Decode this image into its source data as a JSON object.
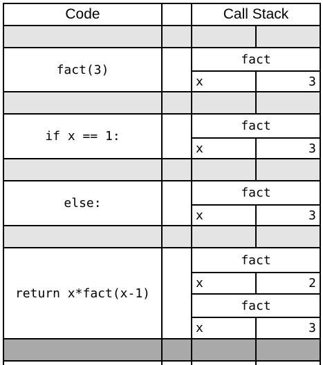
{
  "headers": {
    "code": "Code",
    "call_stack": "Call Stack"
  },
  "rows": [
    {
      "code": "fact(3)",
      "frames": [
        {
          "name": "fact",
          "var": "x",
          "value": "3"
        }
      ]
    },
    {
      "code": "if x == 1:",
      "frames": [
        {
          "name": "fact",
          "var": "x",
          "value": "3"
        }
      ]
    },
    {
      "code": "else:",
      "frames": [
        {
          "name": "fact",
          "var": "x",
          "value": "3"
        }
      ]
    },
    {
      "code": "return x*fact(x-1)",
      "frames": [
        {
          "name": "fact",
          "var": "x",
          "value": "2"
        },
        {
          "name": "fact",
          "var": "x",
          "value": "3"
        }
      ]
    }
  ],
  "colors": {
    "separator_light": "#e4e4e4",
    "separator_dark": "#a9a9a9",
    "line": "#000000"
  }
}
